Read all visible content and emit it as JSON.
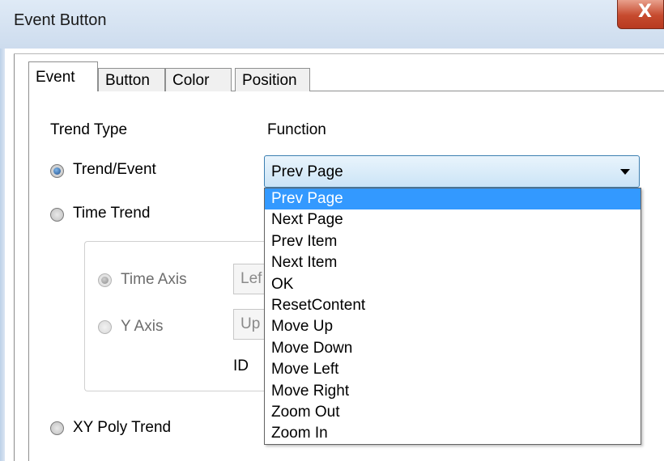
{
  "window": {
    "title": "Event Button",
    "close_label": "X"
  },
  "tabs": [
    {
      "label": "Event"
    },
    {
      "label": "Button"
    },
    {
      "label": "Color"
    },
    {
      "label": "Position"
    }
  ],
  "labels": {
    "trend_type": "Trend Type",
    "function": "Function",
    "id": "ID"
  },
  "trend_options": [
    {
      "label": "Trend/Event",
      "selected": true
    },
    {
      "label": "Time Trend",
      "selected": false
    },
    {
      "label": "XY Poly Trend",
      "selected": false
    }
  ],
  "axis_options": [
    {
      "label": "Time Axis",
      "selected": true,
      "combo_value": "Lef"
    },
    {
      "label": "Y Axis",
      "selected": false,
      "combo_value": "Up"
    }
  ],
  "function_combo": {
    "value": "Prev Page",
    "options": [
      "Prev Page",
      "Next Page",
      "Prev Item",
      "Next Item",
      "OK",
      "ResetContent",
      "Move Up",
      "Move Down",
      "Move Left",
      "Move Right",
      "Zoom Out",
      "Zoom In"
    ],
    "selected_index": 0
  },
  "colors": {
    "selection": "#3399ff",
    "combo_border": "#3c7fb1"
  }
}
